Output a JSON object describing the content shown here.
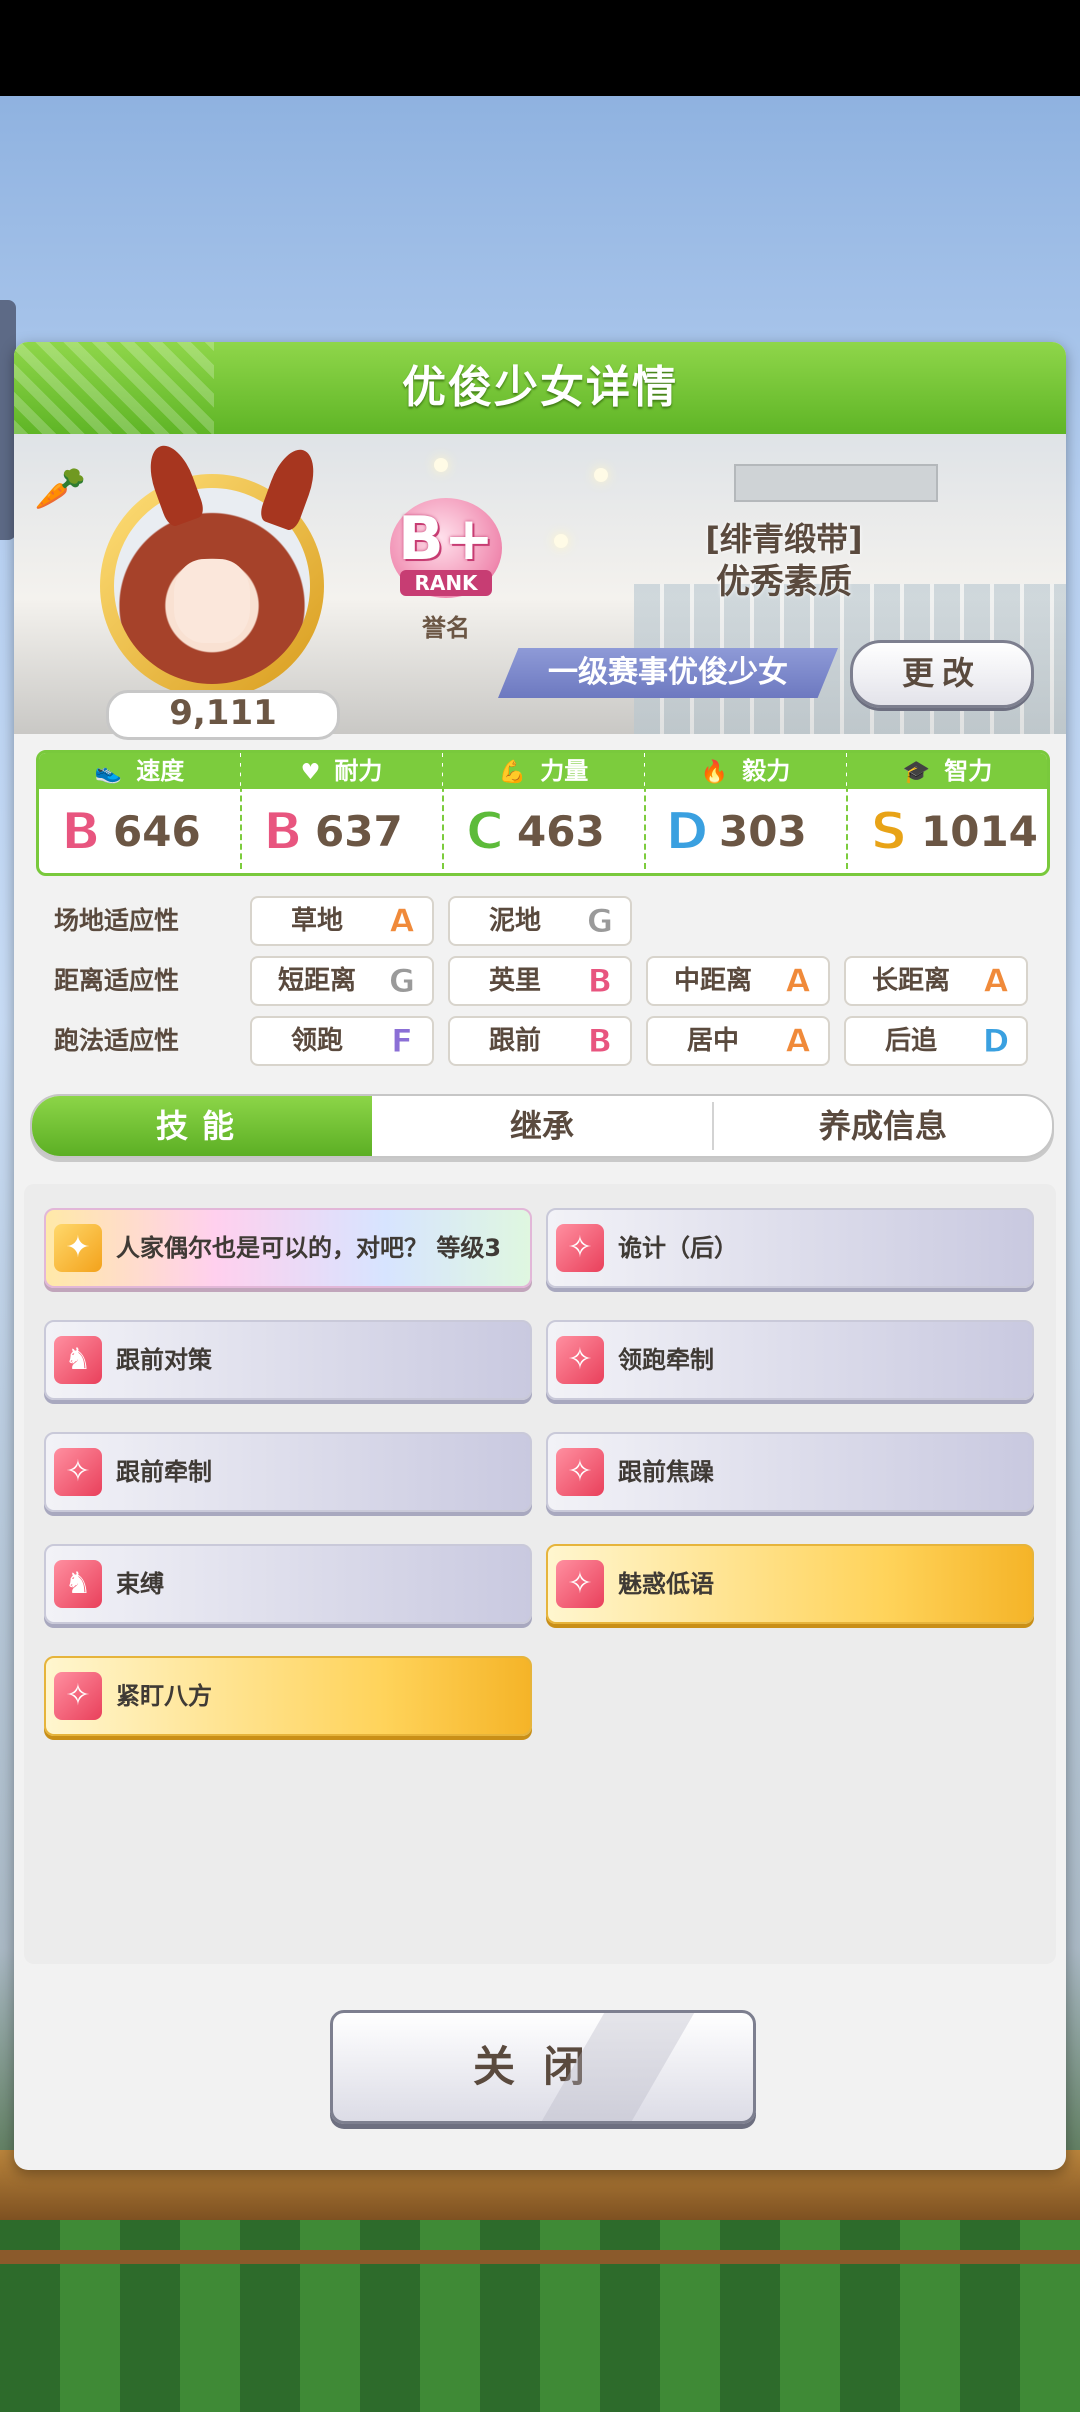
{
  "panel": {
    "title": "优俊少女详情"
  },
  "character": {
    "fans": "9,111",
    "rank": {
      "letter": "B+",
      "label": "RANK",
      "caption": "誉名"
    },
    "epithet": {
      "tag": "[绯青缎带]",
      "name": "优秀素质"
    },
    "title": "一级赛事优俊少女",
    "change_button": "更改"
  },
  "stats": [
    {
      "label": "速度",
      "icon": "shoe-icon",
      "grade": "B",
      "value": "646",
      "grade_color": "#e8557f"
    },
    {
      "label": "耐力",
      "icon": "heart-icon",
      "grade": "B",
      "value": "637",
      "grade_color": "#e8557f"
    },
    {
      "label": "力量",
      "icon": "muscle-icon",
      "grade": "C",
      "value": "463",
      "grade_color": "#5dbb3a"
    },
    {
      "label": "毅力",
      "icon": "flame-icon",
      "grade": "D",
      "value": "303",
      "grade_color": "#3aa0e0"
    },
    {
      "label": "智力",
      "icon": "graduation-cap-icon",
      "grade": "S",
      "value": "1014",
      "grade_color": "#e8a317"
    }
  ],
  "aptitudes": [
    {
      "label": "场地适应性",
      "items": [
        {
          "name": "草地",
          "grade": "A",
          "color": "#f08a3a"
        },
        {
          "name": "泥地",
          "grade": "G",
          "color": "#9a9a9a"
        }
      ]
    },
    {
      "label": "距离适应性",
      "items": [
        {
          "name": "短距离",
          "grade": "G",
          "color": "#9a9a9a"
        },
        {
          "name": "英里",
          "grade": "B",
          "color": "#e8557f"
        },
        {
          "name": "中距离",
          "grade": "A",
          "color": "#f08a3a"
        },
        {
          "name": "长距离",
          "grade": "A",
          "color": "#f08a3a"
        }
      ]
    },
    {
      "label": "跑法适应性",
      "items": [
        {
          "name": "领跑",
          "grade": "F",
          "color": "#8b6fd6"
        },
        {
          "name": "跟前",
          "grade": "B",
          "color": "#e8557f"
        },
        {
          "name": "居中",
          "grade": "A",
          "color": "#f08a3a"
        },
        {
          "name": "后追",
          "grade": "D",
          "color": "#3aa0e0"
        }
      ]
    }
  ],
  "tabs": [
    {
      "label": "技能",
      "active": true
    },
    {
      "label": "继承",
      "active": false
    },
    {
      "label": "养成信息",
      "active": false
    }
  ],
  "skills": [
    {
      "name": "人家偶尔也是可以的，对吧？ 等级3",
      "style": "rainbow",
      "icon": "unique-skill-icon"
    },
    {
      "name": "诡计（后）",
      "style": "normal",
      "icon": "debuff-sparkle-icon"
    },
    {
      "name": "跟前对策",
      "style": "normal",
      "icon": "horse-silhouette-icon"
    },
    {
      "name": "领跑牵制",
      "style": "normal",
      "icon": "debuff-sparkle-icon"
    },
    {
      "name": "跟前牵制",
      "style": "normal",
      "icon": "debuff-sparkle-icon"
    },
    {
      "name": "跟前焦躁",
      "style": "normal",
      "icon": "debuff-sparkle-icon"
    },
    {
      "name": "束缚",
      "style": "normal",
      "icon": "horse-silhouette-icon"
    },
    {
      "name": "魅惑低语",
      "style": "gold",
      "icon": "debuff-sparkle-icon"
    },
    {
      "name": "紧盯八方",
      "style": "gold",
      "icon": "debuff-sparkle-icon"
    }
  ],
  "close_button": "关闭"
}
